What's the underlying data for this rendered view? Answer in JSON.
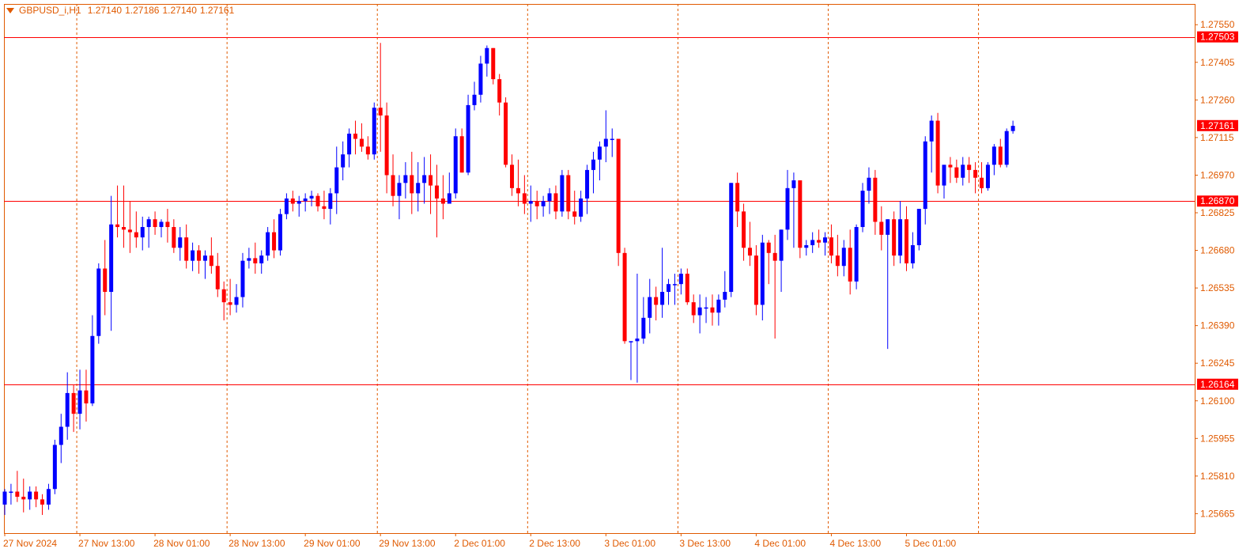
{
  "header": {
    "symbol": "GBPUSD_i,H1",
    "open": "1.27140",
    "high": "1.27186",
    "low": "1.27140",
    "close": "1.27161"
  },
  "colors": {
    "frame": "#e05a00",
    "grid": "#e05a00",
    "bull": "#0000ff",
    "bear": "#ff0000",
    "level_line": "#ff0000",
    "price_tag": "#ff0000",
    "axis_text": "#e05a00"
  },
  "icons": {
    "menu": "triangle-down-icon"
  },
  "chart_data": {
    "type": "candlestick",
    "ylim": [
      1.2559,
      1.2763
    ],
    "y_ticks": [
      "1.27550",
      "1.27405",
      "1.27260",
      "1.27115",
      "1.26970",
      "1.26825",
      "1.26680",
      "1.26535",
      "1.26390",
      "1.26245",
      "1.26100",
      "1.25955",
      "1.25810",
      "1.25665"
    ],
    "x_ticks": [
      "27 Nov 2024",
      "27 Nov 13:00",
      "28 Nov 01:00",
      "28 Nov 13:00",
      "29 Nov 01:00",
      "29 Nov 13:00",
      "2 Dec 01:00",
      "2 Dec 13:00",
      "3 Dec 01:00",
      "3 Dec 13:00",
      "4 Dec 01:00",
      "4 Dec 13:00",
      "5 Dec 01:00"
    ],
    "bars_per_tick": 12,
    "separators_after_ticks": [
      1,
      3,
      5,
      7,
      9,
      11,
      13
    ],
    "grid": "vertical-dashed",
    "levels": [
      {
        "label": "1.27503",
        "value": 1.27503
      },
      {
        "label": "1.26870",
        "value": 1.2687
      },
      {
        "label": "1.26164",
        "value": 1.26164
      }
    ],
    "last_price": {
      "label": "1.27161",
      "value": 1.27161
    },
    "ohlc": [
      [
        1.257,
        1.2576,
        1.2566,
        1.2575
      ],
      [
        1.2575,
        1.2578,
        1.257,
        1.2575
      ],
      [
        1.2575,
        1.2583,
        1.2571,
        1.2573
      ],
      [
        1.2573,
        1.258,
        1.2567,
        1.2572
      ],
      [
        1.2572,
        1.2577,
        1.2568,
        1.2575
      ],
      [
        1.2575,
        1.2577,
        1.2569,
        1.2572
      ],
      [
        1.2572,
        1.2574,
        1.2566,
        1.257
      ],
      [
        1.257,
        1.2578,
        1.2568,
        1.2576
      ],
      [
        1.2576,
        1.2595,
        1.2574,
        1.2593
      ],
      [
        1.2593,
        1.2605,
        1.2586,
        1.26
      ],
      [
        1.26,
        1.2621,
        1.2595,
        1.2613
      ],
      [
        1.2613,
        1.2616,
        1.2598,
        1.2605
      ],
      [
        1.2605,
        1.2622,
        1.2599,
        1.2614
      ],
      [
        1.2614,
        1.2622,
        1.2602,
        1.2609
      ],
      [
        1.2609,
        1.2643,
        1.2608,
        1.2635
      ],
      [
        1.2635,
        1.2663,
        1.2632,
        1.2661
      ],
      [
        1.2661,
        1.2672,
        1.2643,
        1.2652
      ],
      [
        1.2652,
        1.2689,
        1.2637,
        1.2678
      ],
      [
        1.2678,
        1.2693,
        1.2673,
        1.2677
      ],
      [
        1.2677,
        1.2693,
        1.2669,
        1.2676
      ],
      [
        1.2676,
        1.2687,
        1.2667,
        1.2675
      ],
      [
        1.2675,
        1.2683,
        1.2669,
        1.2673
      ],
      [
        1.2673,
        1.2681,
        1.2668,
        1.2677
      ],
      [
        1.2677,
        1.2681,
        1.2669,
        1.268
      ],
      [
        1.268,
        1.2683,
        1.2674,
        1.2677
      ],
      [
        1.2677,
        1.268,
        1.2673,
        1.2679
      ],
      [
        1.2679,
        1.2684,
        1.2671,
        1.2677
      ],
      [
        1.2677,
        1.268,
        1.2667,
        1.2669
      ],
      [
        1.2669,
        1.2677,
        1.2664,
        1.2673
      ],
      [
        1.2673,
        1.2678,
        1.2661,
        1.2664
      ],
      [
        1.2664,
        1.2671,
        1.266,
        1.2668
      ],
      [
        1.2668,
        1.267,
        1.2659,
        1.2664
      ],
      [
        1.2664,
        1.2668,
        1.2657,
        1.2666
      ],
      [
        1.2666,
        1.2673,
        1.2659,
        1.2662
      ],
      [
        1.2662,
        1.2667,
        1.265,
        1.2653
      ],
      [
        1.2653,
        1.2656,
        1.2641,
        1.2648
      ],
      [
        1.2648,
        1.2657,
        1.2643,
        1.2647
      ],
      [
        1.2647,
        1.2655,
        1.2644,
        1.265
      ],
      [
        1.265,
        1.2667,
        1.2646,
        1.2664
      ],
      [
        1.2664,
        1.2669,
        1.2661,
        1.2665
      ],
      [
        1.2665,
        1.2671,
        1.2659,
        1.2663
      ],
      [
        1.2663,
        1.2668,
        1.2659,
        1.2666
      ],
      [
        1.2666,
        1.2677,
        1.2664,
        1.2675
      ],
      [
        1.2675,
        1.268,
        1.2665,
        1.2668
      ],
      [
        1.2668,
        1.2684,
        1.2666,
        1.2682
      ],
      [
        1.2682,
        1.269,
        1.268,
        1.2688
      ],
      [
        1.2688,
        1.2691,
        1.2683,
        1.2686
      ],
      [
        1.2686,
        1.2689,
        1.2681,
        1.2687
      ],
      [
        1.2687,
        1.269,
        1.2683,
        1.2688
      ],
      [
        1.2688,
        1.2691,
        1.2685,
        1.2689
      ],
      [
        1.2689,
        1.269,
        1.2683,
        1.2685
      ],
      [
        1.2685,
        1.2691,
        1.268,
        1.2684
      ],
      [
        1.2684,
        1.2692,
        1.2678,
        1.269
      ],
      [
        1.269,
        1.2708,
        1.2682,
        1.27
      ],
      [
        1.27,
        1.271,
        1.2695,
        1.2705
      ],
      [
        1.2705,
        1.2715,
        1.27,
        1.2713
      ],
      [
        1.2713,
        1.2718,
        1.2705,
        1.2711
      ],
      [
        1.2711,
        1.2717,
        1.2706,
        1.2708
      ],
      [
        1.2708,
        1.2712,
        1.2703,
        1.2705
      ],
      [
        1.2705,
        1.2725,
        1.2703,
        1.2723
      ],
      [
        1.2723,
        1.2748,
        1.2706,
        1.272
      ],
      [
        1.272,
        1.2725,
        1.269,
        1.2697
      ],
      [
        1.2697,
        1.2705,
        1.2685,
        1.2689
      ],
      [
        1.2689,
        1.2697,
        1.268,
        1.2694
      ],
      [
        1.2694,
        1.2702,
        1.2688,
        1.2697
      ],
      [
        1.2697,
        1.2706,
        1.2682,
        1.269
      ],
      [
        1.269,
        1.2702,
        1.2683,
        1.2694
      ],
      [
        1.2694,
        1.2704,
        1.2686,
        1.2697
      ],
      [
        1.2697,
        1.2705,
        1.2682,
        1.2693
      ],
      [
        1.2693,
        1.2701,
        1.2673,
        1.2688
      ],
      [
        1.2688,
        1.2697,
        1.268,
        1.2686
      ],
      [
        1.2686,
        1.2698,
        1.2687,
        1.269
      ],
      [
        1.269,
        1.2715,
        1.2688,
        1.2712
      ],
      [
        1.2712,
        1.2715,
        1.2698,
        1.2698
      ],
      [
        1.2698,
        1.2728,
        1.2697,
        1.2724
      ],
      [
        1.2724,
        1.2733,
        1.2722,
        1.2728
      ],
      [
        1.2728,
        1.2743,
        1.2725,
        1.274
      ],
      [
        1.274,
        1.2747,
        1.2735,
        1.2746
      ],
      [
        1.2746,
        1.2746,
        1.2732,
        1.2734
      ],
      [
        1.2734,
        1.2736,
        1.272,
        1.2725
      ],
      [
        1.2725,
        1.2727,
        1.27,
        1.2701
      ],
      [
        1.2701,
        1.2705,
        1.2689,
        1.2692
      ],
      [
        1.2692,
        1.2703,
        1.2685,
        1.269
      ],
      [
        1.269,
        1.2697,
        1.2682,
        1.2686
      ],
      [
        1.2686,
        1.2693,
        1.2679,
        1.2687
      ],
      [
        1.2687,
        1.2691,
        1.268,
        1.2685
      ],
      [
        1.2685,
        1.2689,
        1.2681,
        1.2687
      ],
      [
        1.2687,
        1.2692,
        1.2682,
        1.269
      ],
      [
        1.269,
        1.2693,
        1.268,
        1.2683
      ],
      [
        1.2683,
        1.2699,
        1.2681,
        1.2697
      ],
      [
        1.2697,
        1.2699,
        1.268,
        1.2683
      ],
      [
        1.2683,
        1.2691,
        1.2678,
        1.2681
      ],
      [
        1.2681,
        1.2691,
        1.2679,
        1.2688
      ],
      [
        1.2688,
        1.2701,
        1.2682,
        1.2699
      ],
      [
        1.2699,
        1.2706,
        1.269,
        1.2703
      ],
      [
        1.2703,
        1.271,
        1.2695,
        1.2708
      ],
      [
        1.2708,
        1.2722,
        1.2702,
        1.2711
      ],
      [
        1.2711,
        1.2715,
        1.2704,
        1.2711
      ],
      [
        1.2711,
        1.2711,
        1.2662,
        1.2667
      ],
      [
        1.2667,
        1.2669,
        1.2632,
        1.2633
      ],
      [
        1.2633,
        1.2633,
        1.2618,
        1.2633
      ],
      [
        1.2633,
        1.2659,
        1.2617,
        1.2634
      ],
      [
        1.2634,
        1.265,
        1.2632,
        1.2642
      ],
      [
        1.2642,
        1.2657,
        1.2636,
        1.265
      ],
      [
        1.265,
        1.2654,
        1.2641,
        1.2647
      ],
      [
        1.2647,
        1.2669,
        1.2642,
        1.2652
      ],
      [
        1.2652,
        1.2657,
        1.2647,
        1.2655
      ],
      [
        1.2655,
        1.2659,
        1.2647,
        1.2655
      ],
      [
        1.2655,
        1.2661,
        1.2651,
        1.2659
      ],
      [
        1.2659,
        1.2661,
        1.2647,
        1.2648
      ],
      [
        1.2648,
        1.2651,
        1.264,
        1.2643
      ],
      [
        1.2643,
        1.2651,
        1.2636,
        1.2646
      ],
      [
        1.2646,
        1.265,
        1.264,
        1.2646
      ],
      [
        1.2646,
        1.2651,
        1.2639,
        1.2644
      ],
      [
        1.2644,
        1.2651,
        1.2639,
        1.2649
      ],
      [
        1.2649,
        1.266,
        1.2646,
        1.2652
      ],
      [
        1.2652,
        1.2694,
        1.265,
        1.2694
      ],
      [
        1.2694,
        1.2698,
        1.2677,
        1.2683
      ],
      [
        1.2683,
        1.2686,
        1.2664,
        1.2669
      ],
      [
        1.2669,
        1.2679,
        1.2662,
        1.2666
      ],
      [
        1.2666,
        1.267,
        1.2643,
        1.2647
      ],
      [
        1.2647,
        1.2674,
        1.2641,
        1.2671
      ],
      [
        1.2671,
        1.2672,
        1.2655,
        1.2667
      ],
      [
        1.2667,
        1.2674,
        1.2634,
        1.2664
      ],
      [
        1.2664,
        1.2676,
        1.2652,
        1.2676
      ],
      [
        1.2676,
        1.2699,
        1.2672,
        1.2692
      ],
      [
        1.2692,
        1.2698,
        1.2669,
        1.2695
      ],
      [
        1.2695,
        1.2695,
        1.2665,
        1.2669
      ],
      [
        1.2669,
        1.2672,
        1.2666,
        1.267
      ],
      [
        1.267,
        1.2675,
        1.2667,
        1.2672
      ],
      [
        1.2672,
        1.2676,
        1.2669,
        1.2671
      ],
      [
        1.2671,
        1.2675,
        1.2666,
        1.2673
      ],
      [
        1.2673,
        1.2678,
        1.2663,
        1.2666
      ],
      [
        1.2666,
        1.2674,
        1.2658,
        1.2662
      ],
      [
        1.2662,
        1.2672,
        1.2658,
        1.2669
      ],
      [
        1.2669,
        1.2676,
        1.2651,
        1.2656
      ],
      [
        1.2656,
        1.2678,
        1.2653,
        1.2677
      ],
      [
        1.2677,
        1.2694,
        1.2675,
        1.2691
      ],
      [
        1.2691,
        1.27,
        1.2686,
        1.2696
      ],
      [
        1.2696,
        1.2699,
        1.2674,
        1.2679
      ],
      [
        1.2679,
        1.2685,
        1.2668,
        1.2674
      ],
      [
        1.2674,
        1.268,
        1.263,
        1.268
      ],
      [
        1.268,
        1.2683,
        1.2662,
        1.2666
      ],
      [
        1.2666,
        1.2687,
        1.2663,
        1.268
      ],
      [
        1.268,
        1.2685,
        1.266,
        1.2663
      ],
      [
        1.2663,
        1.2675,
        1.2661,
        1.267
      ],
      [
        1.267,
        1.2684,
        1.2668,
        1.2684
      ],
      [
        1.2684,
        1.2712,
        1.2678,
        1.271
      ],
      [
        1.271,
        1.272,
        1.2698,
        1.2718
      ],
      [
        1.2718,
        1.2721,
        1.269,
        1.2693
      ],
      [
        1.2693,
        1.27,
        1.2688,
        1.2701
      ],
      [
        1.2701,
        1.2704,
        1.2694,
        1.27
      ],
      [
        1.27,
        1.2703,
        1.2694,
        1.2696
      ],
      [
        1.2696,
        1.2704,
        1.2693,
        1.2701
      ],
      [
        1.2701,
        1.2704,
        1.2694,
        1.2699
      ],
      [
        1.2699,
        1.2702,
        1.269,
        1.2696
      ],
      [
        1.2696,
        1.2702,
        1.269,
        1.2692
      ],
      [
        1.2692,
        1.2702,
        1.2691,
        1.2701
      ],
      [
        1.2701,
        1.2709,
        1.2697,
        1.2708
      ],
      [
        1.2708,
        1.2711,
        1.27,
        1.2701
      ],
      [
        1.2701,
        1.2715,
        1.27,
        1.2714
      ],
      [
        1.2714,
        1.2718,
        1.2713,
        1.2716
      ]
    ]
  }
}
